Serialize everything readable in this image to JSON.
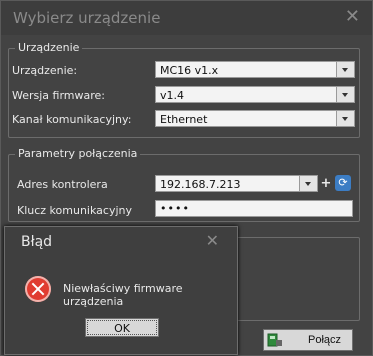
{
  "window": {
    "title": "Wybierz urządzenie",
    "close_icon": "close-icon"
  },
  "device_group": {
    "legend": "Urządzenie",
    "device_label": "Urządzenie:",
    "device_value": "MC16 v1.x",
    "firmware_label": "Wersja firmware:",
    "firmware_value": "v1.4",
    "channel_label": "Kanał komunikacyjny:",
    "channel_value": "Ethernet"
  },
  "connection_group": {
    "legend": "Parametry połączenia",
    "address_label": "Adres kontrolera",
    "address_value": "192.168.7.213",
    "add_symbol": "+",
    "key_label": "Klucz komunikacyjny",
    "key_value": "••••"
  },
  "footer": {
    "connect_label": "Połącz"
  },
  "error_dialog": {
    "title": "Błąd",
    "message": "Niewłaściwy firmware urządzenia",
    "ok_label": "OK"
  }
}
